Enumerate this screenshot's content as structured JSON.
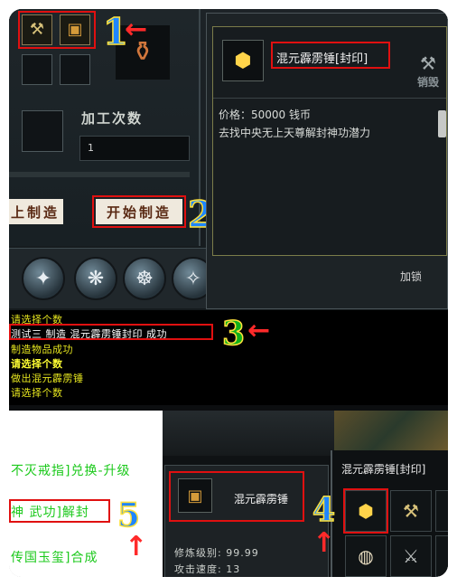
{
  "craft": {
    "process_count_label": "加工次数",
    "process_count_value": "1",
    "prev_button": "上制造",
    "start_button": "开始制造"
  },
  "tooltip": {
    "item_name": "混元霹雳锤[封印]",
    "destroy_label": "销毁",
    "price": "价格：50000 钱币",
    "description": "去找中央无上天尊解封神功潜力",
    "lock_label": "加锁"
  },
  "chat": [
    {
      "text": "请选择个数",
      "color": "#e6e61f"
    },
    {
      "text": "测试三 制造 混元霹雳锤封印 成功",
      "color": "#ffffff"
    },
    {
      "text": "制造物品成功",
      "color": "#e6e61f"
    },
    {
      "text": "请选择个数",
      "color": "#ffff33"
    },
    {
      "text": "做出混元霹雳锤",
      "color": "#e6e61f"
    },
    {
      "text": "请选择个数",
      "color": "#e6e61f"
    }
  ],
  "menu": {
    "line1": "不灭戒指]兑换-升级",
    "line2": "神 武功]解封",
    "line3": "传国玉玺]合成"
  },
  "bag": {
    "title": "混元霹雳锤[封印]"
  },
  "stats": {
    "item_name": "混元霹雳锤",
    "level": "修炼级别: 99.99",
    "speed": "攻击速度: 13"
  },
  "annotations": {
    "n1": "1",
    "n2": "2",
    "n3": "3",
    "n4": "4",
    "n5": "5",
    "arrow_left": "←",
    "arrow_up": "↑"
  }
}
